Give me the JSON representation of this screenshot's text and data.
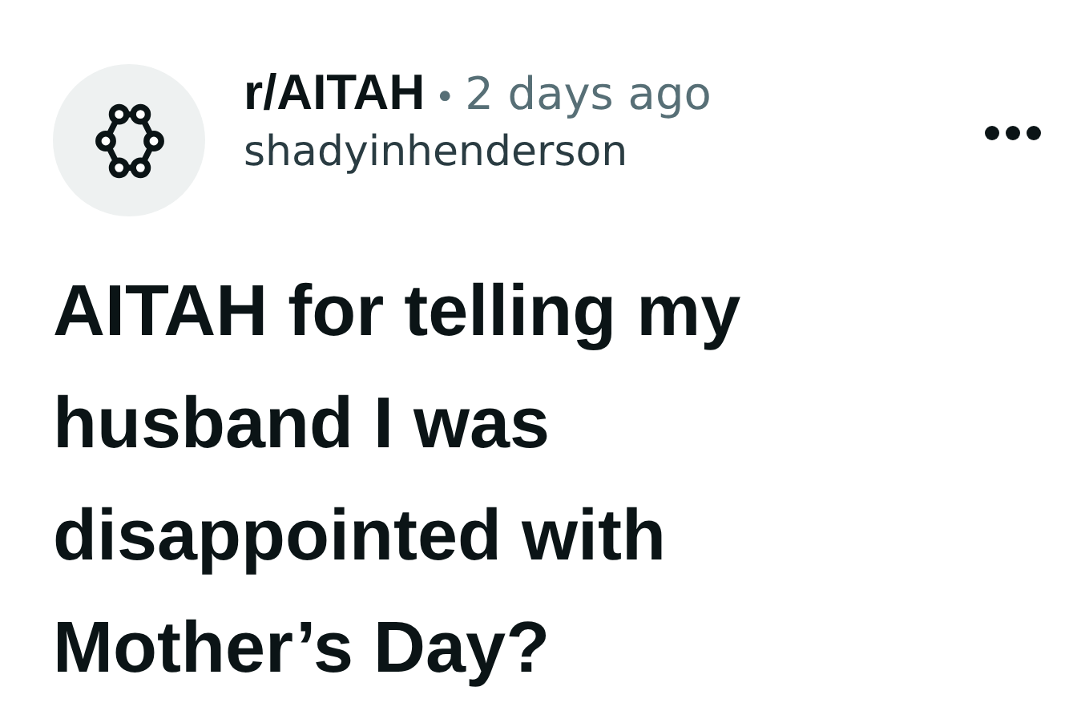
{
  "post": {
    "subreddit": "r/AITAH",
    "separator": "•",
    "age": "2 days ago",
    "author": "shadyinhenderson",
    "title": "AITAH for telling my husband I was disappointed with Mother’s Day?"
  }
}
